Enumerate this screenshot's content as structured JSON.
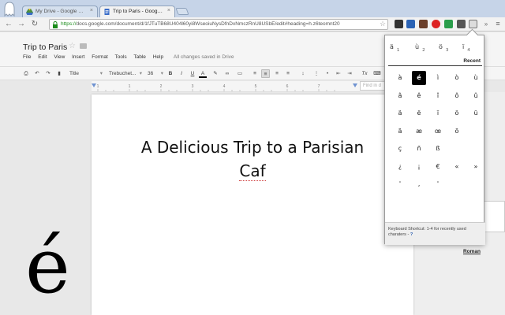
{
  "tabs": [
    {
      "label": "My Drive - Google Drive",
      "active": false
    },
    {
      "label": "Trip to Paris - Google Drive",
      "active": true
    }
  ],
  "address_bar": {
    "scheme": "https://",
    "url_rest": "docs.google.com/document/d/1fJTuTB68U404l60yi8WseoiuNysDfnDxNmczRnU8USbE/edit#heading=h.z6teomnt20"
  },
  "document": {
    "title": "Trip to Paris",
    "menu": [
      "File",
      "Edit",
      "View",
      "Insert",
      "Format",
      "Tools",
      "Table",
      "Help"
    ],
    "save_status": "All changes saved in Drive",
    "heading_line1": "A Delicious Trip to a Parisian",
    "heading_line2": "Caf"
  },
  "format_toolbar": {
    "style": "Title",
    "font": "Trebuchet...",
    "size": "36",
    "bold": "B",
    "italic": "I",
    "underline": "U",
    "text_color": "A",
    "clear_format": "Tx"
  },
  "find_box": {
    "placeholder": "Find in d"
  },
  "ruler_numbers": [
    "1",
    "1",
    "2",
    "3",
    "4",
    "5",
    "6",
    "7"
  ],
  "big_preview_char": "é",
  "popup": {
    "recent": [
      {
        "char": "ä",
        "index": "1"
      },
      {
        "char": "ù",
        "index": "2"
      },
      {
        "char": "ö",
        "index": "3"
      },
      {
        "char": "ï",
        "index": "4"
      }
    ],
    "recent_label": "Recent",
    "grid": [
      [
        "à",
        "é",
        "ì",
        "ò",
        "ù"
      ],
      [
        "â",
        "ê",
        "î",
        "ô",
        "û"
      ],
      [
        "ä",
        "ë",
        "ï",
        "ö",
        "ü"
      ],
      [
        "ã",
        "æ",
        "œ",
        "õ",
        ""
      ],
      [
        "ç",
        "ñ",
        "ß",
        "",
        ""
      ],
      [
        "¿",
        "¡",
        "€",
        "«",
        "»"
      ],
      [
        "'",
        "‚",
        "'",
        "",
        ""
      ]
    ],
    "selected_char": "é",
    "roman_label": "Roman",
    "footer_text": "Keyboard Shortcut: 1-4 for recently used charaters -",
    "help_label": "?"
  },
  "colors": {
    "tab_strip": "#c6d4e8",
    "link_blue": "#2a5db0",
    "ruler_marker": "#6f93d1",
    "https_green": "#1a8c1a"
  }
}
